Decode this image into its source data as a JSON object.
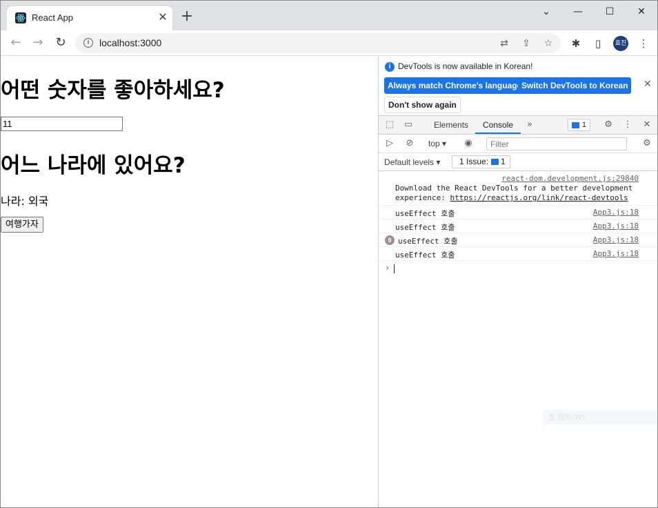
{
  "browser": {
    "tab_title": "React App",
    "new_tab": "+",
    "tab_close": "✕",
    "url": "localhost:3000",
    "profile": "효진",
    "controls": {
      "minimize": "⌄",
      "min": "—",
      "max": "☐",
      "close": "✕"
    }
  },
  "page": {
    "heading1": "어떤 숫자를 좋아하세요?",
    "number_value": "11",
    "heading2": "어느 나라에 있어요?",
    "country_text": "나라: 외국",
    "travel_button": "여행가자"
  },
  "devtools": {
    "info_message": "DevTools is now available in Korean!",
    "btn_match": "Always match Chrome's language",
    "btn_switch": "Switch DevTools to Korean",
    "btn_dont_show": "Don't show again",
    "tabs": {
      "elements": "Elements",
      "console": "Console",
      "more": "»"
    },
    "issues_count": "1",
    "context": "top",
    "filter_placeholder": "Filter",
    "levels": "Default levels",
    "issue_label": "1 Issue:",
    "issue_count2": "1",
    "logs": [
      {
        "source": "react-dom.development.js:29840",
        "text_line1": "Download the React DevTools for a better development",
        "text_line2a": "experience: ",
        "link": "https://reactjs.org/link/react-devtools"
      },
      {
        "source": "App3.js:18",
        "text": "useEffect 호출"
      },
      {
        "source": "App3.js:18",
        "text": "useEffect 호출"
      },
      {
        "source": "App3.js:18",
        "text": "useEffect 호출",
        "repeat": "9"
      },
      {
        "source": "App3.js:18",
        "text": "useEffect 호출"
      }
    ],
    "prompt": "›",
    "overlay_text": "창 캡처(W)"
  }
}
